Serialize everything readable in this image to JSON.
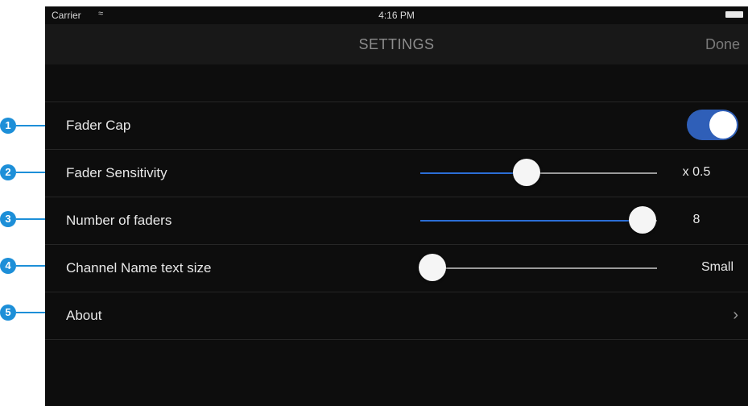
{
  "status_bar": {
    "carrier": "Carrier",
    "time": "4:16 PM"
  },
  "nav": {
    "title": "SETTINGS",
    "done": "Done"
  },
  "rows": [
    {
      "label": "Fader Cap",
      "control": "toggle",
      "on": true
    },
    {
      "label": "Fader Sensitivity",
      "control": "slider",
      "level": 0.45,
      "value": "x 0.5"
    },
    {
      "label": "Number of faders",
      "control": "slider",
      "level": 0.94,
      "value": "8"
    },
    {
      "label": "Channel Name text size",
      "control": "slider",
      "level": 0.05,
      "value": "Small"
    },
    {
      "label": "About",
      "control": "disclosure"
    }
  ],
  "callouts": [
    "1",
    "2",
    "3",
    "4",
    "5"
  ],
  "colors": {
    "accent": "#2f5fb8",
    "callout": "#1d8fd8",
    "background": "#0d0d0d"
  }
}
